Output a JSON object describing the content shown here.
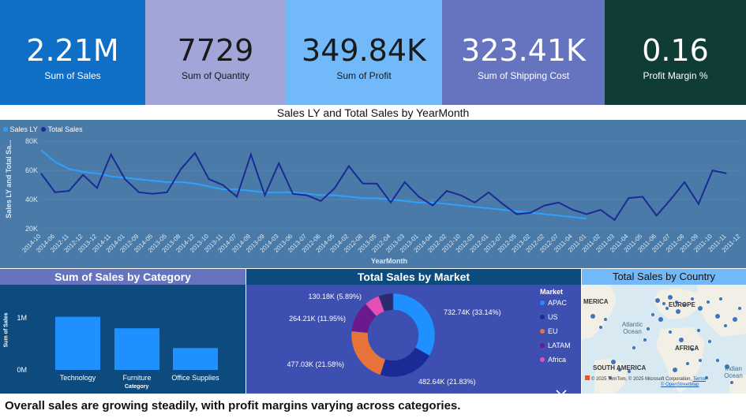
{
  "kpis": [
    {
      "value": "2.21M",
      "label": "Sum of Sales"
    },
    {
      "value": "7729",
      "label": "Sum of Quantity"
    },
    {
      "value": "349.84K",
      "label": "Sum of Profit"
    },
    {
      "value": "323.41K",
      "label": "Sum of Shipping Cost"
    },
    {
      "value": "0.16",
      "label": "Profit Margin %"
    }
  ],
  "colors": {
    "kpi1": "#0f6fc6",
    "kpi2": "#a1a5d8",
    "kpi3": "#72b9f9",
    "kpi4": "#6673be",
    "kpi5": "#0f3d36",
    "line_panel": "#4a7aa7",
    "category_panel": "#0d4b7f",
    "market_panel": "#3d4fb0",
    "sales_ly": "#2ea1ff",
    "total_sales": "#1a2a96",
    "apac": "#1e90ff",
    "us": "#1a2a96",
    "eu": "#e8733a",
    "latam": "#6b1a8c",
    "africa": "#e54fb4"
  },
  "line_chart": {
    "title": "Sales LY and Total Sales by YearMonth",
    "legend": {
      "sales_ly": "Sales LY",
      "total_sales": "Total Sales"
    },
    "ylabel": "Sales LY and Total Sa...",
    "xlabel": "YearMonth"
  },
  "category_chart": {
    "title": "Sum of Sales by Category",
    "ylabel": "Sum of Sales",
    "xlabel": "Category",
    "y_ticks": [
      "1M",
      "0M"
    ]
  },
  "market_chart": {
    "title": "Total Sales by Market",
    "legend_title": "Market",
    "more_icon": "chevron-down-icon"
  },
  "map": {
    "title": "Total Sales by Country",
    "labels": {
      "america": "MERICA",
      "europe": "EUROPE",
      "atlantic": "Atlantic\nOcean",
      "africa": "AFRICA",
      "south_america": "SOUTH AMERICA",
      "indian": "Indian\nOcean"
    },
    "copyright": "© 2025 TomTom, © 2025 Microsoft Corporation,",
    "osm": "© OpenStreetMap",
    "terms": "Terms"
  },
  "footer": "Overall sales are growing steadily, with profit margins varying across categories.",
  "chart_data": [
    {
      "type": "line",
      "title": "Sales LY and Total Sales by YearMonth",
      "xlabel": "YearMonth",
      "ylabel": "Sales LY and Total Sa...",
      "ylim": [
        20000,
        85000
      ],
      "y_ticks": [
        "80K",
        "60K",
        "40K",
        "20K"
      ],
      "y_tick_values": [
        80000,
        60000,
        40000,
        20000
      ],
      "categories": [
        "2014-10",
        "2014-06",
        "2012-11",
        "2012-12",
        "2013-12",
        "2014-11",
        "2014-01",
        "2012-09",
        "2014-05",
        "2013-05",
        "2013-08",
        "2014-12",
        "2013-10",
        "2013-11",
        "2014-07",
        "2014-09",
        "2013-09",
        "2014-03",
        "2013-06",
        "2013-07",
        "2012-06",
        "2014-05",
        "2014-02",
        "2012-08",
        "2013-05",
        "2012-04",
        "2013-03",
        "2013-01",
        "2014-04",
        "2012-02",
        "2012-10",
        "2012-03",
        "2012-01",
        "2012-07",
        "2012-05",
        "2013-02",
        "2012-02",
        "2012-07",
        "2011-04",
        "2011-01",
        "2011-02",
        "2011-03",
        "2011-04",
        "2011-05",
        "2011-06",
        "2011-07",
        "2011-08",
        "2011-09",
        "2011-10",
        "2011-11",
        "2011-12"
      ],
      "series": [
        {
          "name": "Sales LY",
          "values": [
            74000,
            66000,
            61000,
            59000,
            58000,
            56000,
            55000,
            54000,
            53000,
            52000,
            52000,
            51000,
            49000,
            47000,
            47000,
            46000,
            45000,
            45000,
            45000,
            44000,
            43000,
            43000,
            42000,
            41000,
            41000,
            40000,
            39000,
            38000,
            38000,
            37000,
            36000,
            35000,
            34000,
            33000,
            32000,
            31000,
            30000,
            29000,
            28000,
            27000
          ]
        },
        {
          "name": "Total Sales",
          "values": [
            58000,
            45000,
            46000,
            57000,
            48000,
            71000,
            54000,
            45000,
            44000,
            45000,
            61000,
            72000,
            54000,
            50000,
            42000,
            71000,
            43000,
            65000,
            44000,
            43000,
            39000,
            48000,
            63000,
            51000,
            51000,
            38000,
            52000,
            42000,
            36000,
            46000,
            43000,
            38000,
            45000,
            37000,
            30000,
            31000,
            36000,
            38000,
            33000,
            30000,
            33000,
            26000,
            41000,
            42000,
            29000,
            40000,
            52000,
            37000,
            60000,
            58000
          ]
        }
      ]
    },
    {
      "type": "bar",
      "title": "Sum of Sales by Category",
      "categories": [
        "Technology",
        "Furniture",
        "Office Supplies"
      ],
      "values": [
        1020000,
        800000,
        420000
      ],
      "xlabel": "Category",
      "ylabel": "Sum of Sales",
      "ylim": [
        0,
        1000000
      ],
      "y_ticks": [
        "1M",
        "0M"
      ]
    },
    {
      "type": "pie",
      "title": "Total Sales by Market",
      "categories": [
        "APAC",
        "US",
        "EU",
        "LATAM",
        "Africa"
      ],
      "values": [
        732.74,
        482.64,
        477.03,
        264.21,
        130.18
      ],
      "data_labels": [
        "732.74K (33.14%)",
        "482.64K (21.83%)",
        "477.03K (21.58%)",
        "264.21K (11.95%)",
        "130.18K (5.89%)"
      ],
      "percents": [
        33.14,
        21.83,
        21.58,
        11.95,
        5.89
      ],
      "extra_slice_percent": 5.61,
      "legend_title": "Market",
      "legend_position": "right"
    }
  ]
}
